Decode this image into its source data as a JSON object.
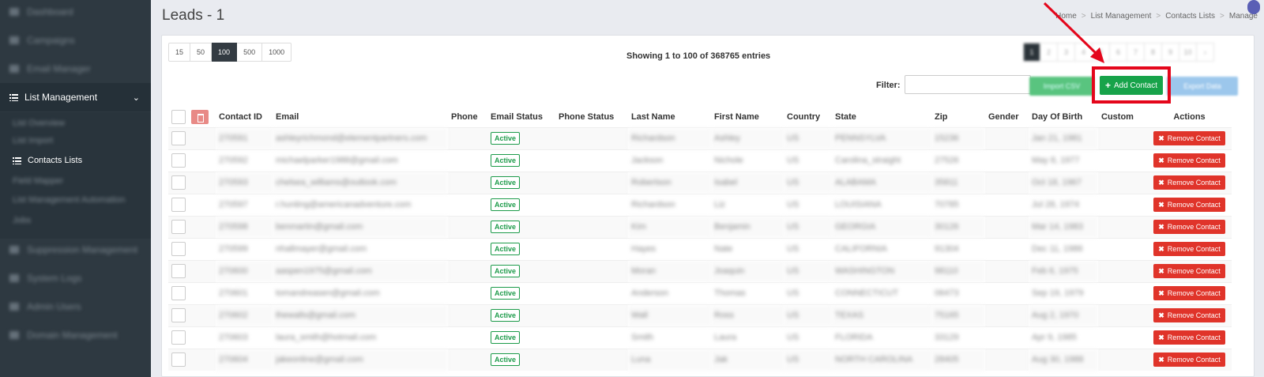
{
  "sidebar": {
    "items_top": [
      "Dashboard",
      "Campaigns",
      "Email Manager"
    ],
    "list_management": "List Management",
    "sub_items": [
      "List Overview",
      "List Import",
      "Contacts Lists",
      "Field Mapper",
      "List Management Automation",
      "Jobs"
    ],
    "contacts_lists": "Contacts Lists",
    "items_bottom": [
      "Suppression Management",
      "System Logs",
      "Admin Users",
      "Domain Management"
    ]
  },
  "header": {
    "title": "Leads - 1",
    "breadcrumb": [
      "Home",
      "List Management",
      "Contacts Lists",
      "Manage"
    ]
  },
  "toolbar": {
    "page_sizes": [
      "15",
      "50",
      "100",
      "500",
      "1000"
    ],
    "active_page_size": "100",
    "showing": "Showing 1 to 100 of 368765 entries",
    "pages": [
      "1",
      "2",
      "3",
      "4",
      "5",
      "6",
      "7",
      "8",
      "9",
      "10",
      "›"
    ],
    "filter_label": "Filter:",
    "filter_value": "",
    "import_label": "Import CSV",
    "add_contact_label": "Add Contact",
    "export_label": "Export Data"
  },
  "table": {
    "columns": [
      "Contact ID",
      "Email",
      "Phone",
      "Email Status",
      "Phone Status",
      "Last Name",
      "First Name",
      "Country",
      "State",
      "Zip",
      "Gender",
      "Day Of Birth",
      "Custom",
      "Actions"
    ],
    "rows": [
      {
        "id": "270591",
        "email": "ashleyrichmond@elementpartners.com",
        "status": "Active",
        "last": "Richardson",
        "first": "Ashley",
        "country": "US",
        "state": "PENNSYLVA",
        "zip": "15236",
        "dob": "Jan 21, 1981",
        "action": "Remove Contact"
      },
      {
        "id": "270592",
        "email": "michaelparker1988@gmail.com",
        "status": "Active",
        "last": "Jackson",
        "first": "Nichole",
        "country": "US",
        "state": "Carolina_straight",
        "zip": "27526",
        "dob": "May 8, 1977",
        "action": "Remove Contact"
      },
      {
        "id": "270593",
        "email": "chelsea_williams@outlook.com",
        "status": "Active",
        "last": "Robertson",
        "first": "Isabel",
        "country": "US",
        "state": "ALABAMA",
        "zip": "35811",
        "dob": "Oct 18, 1967",
        "action": "Remove Contact"
      },
      {
        "id": "270597",
        "email": "r.hunting@americanadventure.com",
        "status": "Active",
        "last": "Richardson",
        "first": "Liz",
        "country": "US",
        "state": "LOUISIANA",
        "zip": "70785",
        "dob": "Jul 28, 1974",
        "action": "Remove Contact"
      },
      {
        "id": "270598",
        "email": "benmartin@gmail.com",
        "status": "Active",
        "last": "Kim",
        "first": "Benjamin",
        "country": "US",
        "state": "GEORGIA",
        "zip": "30126",
        "dob": "Mar 14, 1983",
        "action": "Remove Contact"
      },
      {
        "id": "270599",
        "email": "nhallmayer@gmail.com",
        "status": "Active",
        "last": "Hayes",
        "first": "Nate",
        "country": "US",
        "state": "CALIFORNIA",
        "zip": "91304",
        "dob": "Dec 11, 1986",
        "action": "Remove Contact"
      },
      {
        "id": "270600",
        "email": "aaspen1975@gmail.com",
        "status": "Active",
        "last": "Moran",
        "first": "Joaquin",
        "country": "US",
        "state": "WASHINGTON",
        "zip": "98110",
        "dob": "Feb 6, 1975",
        "action": "Remove Contact"
      },
      {
        "id": "270601",
        "email": "tomandreasen@gmail.com",
        "status": "Active",
        "last": "Anderson",
        "first": "Thomas",
        "country": "US",
        "state": "CONNECTICUT",
        "zip": "06473",
        "dob": "Sep 19, 1979",
        "action": "Remove Contact"
      },
      {
        "id": "270602",
        "email": "thewalls@gmail.com",
        "status": "Active",
        "last": "Wall",
        "first": "Ross",
        "country": "US",
        "state": "TEXAS",
        "zip": "75165",
        "dob": "Aug 2, 1970",
        "action": "Remove Contact"
      },
      {
        "id": "270603",
        "email": "laura_smith@hotmail.com",
        "status": "Active",
        "last": "Smith",
        "first": "Laura",
        "country": "US",
        "state": "FLORIDA",
        "zip": "33129",
        "dob": "Apr 9, 1985",
        "action": "Remove Contact"
      },
      {
        "id": "270604",
        "email": "jakeonline@gmail.com",
        "status": "Active",
        "last": "Luna",
        "first": "Jak",
        "country": "US",
        "state": "NORTH CAROLINA",
        "zip": "28405",
        "dob": "Aug 30, 1988",
        "action": "Remove Contact"
      }
    ]
  }
}
